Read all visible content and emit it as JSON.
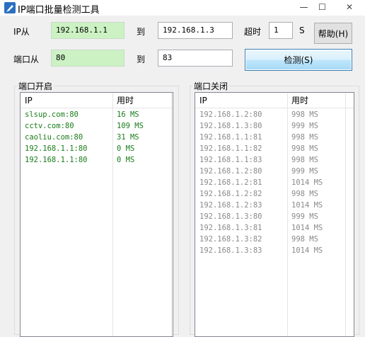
{
  "window": {
    "title": "IP端口批量检测工具",
    "controls": {
      "minimize": "—",
      "maximize": "☐",
      "close": "✕"
    }
  },
  "form": {
    "ip_from_label": "IP从",
    "ip_from_value": "192.168.1.1",
    "ip_to_label": "到",
    "ip_to_value": "192.168.1.3",
    "timeout_label": "超时",
    "timeout_value": "1",
    "timeout_unit": "S",
    "help_button": "帮助(H)",
    "port_from_label": "端口从",
    "port_from_value": "80",
    "port_to_label": "到",
    "port_to_value": "83",
    "detect_button": "检测(S)"
  },
  "open_ports": {
    "title": "端口开启",
    "columns": [
      "IP",
      "用时"
    ],
    "rows": [
      [
        "slsup.com:80",
        "16 MS"
      ],
      [
        "cctv.com:80",
        "109 MS"
      ],
      [
        "caoliu.com:80",
        "31 MS"
      ],
      [
        "192.168.1.1:80",
        "0 MS"
      ],
      [
        "192.168.1.1:80",
        "0 MS"
      ]
    ]
  },
  "closed_ports": {
    "title": "端口关闭",
    "columns": [
      "IP",
      "用时"
    ],
    "rows": [
      [
        "192.168.1.2:80",
        "998 MS"
      ],
      [
        "192.168.1.3:80",
        "999 MS"
      ],
      [
        "192.168.1.1:81",
        "998 MS"
      ],
      [
        "192.168.1.1:82",
        "998 MS"
      ],
      [
        "192.168.1.1:83",
        "998 MS"
      ],
      [
        "192.168.1.2:80",
        "999 MS"
      ],
      [
        "192.168.1.2:81",
        "1014 MS"
      ],
      [
        "192.168.1.2:82",
        "998 MS"
      ],
      [
        "192.168.1.2:83",
        "1014 MS"
      ],
      [
        "192.168.1.3:80",
        "999 MS"
      ],
      [
        "192.168.1.3:81",
        "1014 MS"
      ],
      [
        "192.168.1.3:82",
        "998 MS"
      ],
      [
        "192.168.1.3:83",
        "1014 MS"
      ]
    ]
  },
  "colors": {
    "open_text": "#1a7d1a",
    "closed_text": "#8a8a8a",
    "ip_field_bg": "#ccf2c4"
  }
}
